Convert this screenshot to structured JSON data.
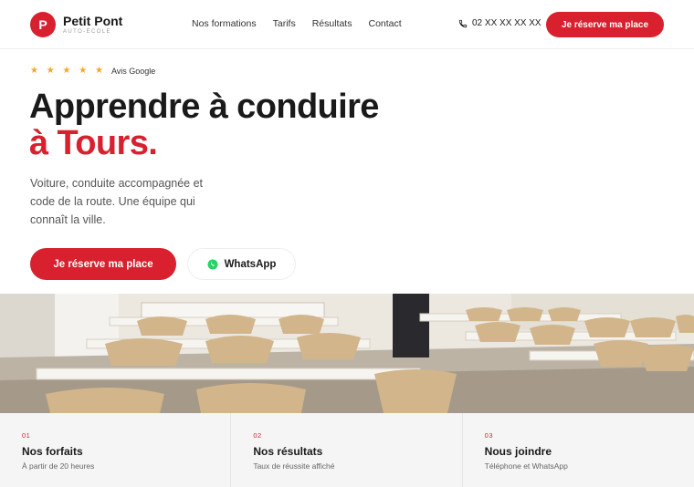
{
  "brand": {
    "mark": "P",
    "name": "Petit Pont",
    "tagline": "AUTO-ÉCOLE",
    "accent": "#d8202e"
  },
  "nav": [
    "Nos formations",
    "Tarifs",
    "Résultats",
    "Contact"
  ],
  "header": {
    "phone": "02 XX XX XX XX",
    "cta": "Je réserve ma place"
  },
  "hero": {
    "stars": "★ ★ ★ ★ ★",
    "reviews_label": "Avis Google",
    "title_line1": "Apprendre à conduire",
    "title_line2": "à Tours.",
    "lead": "Voiture, conduite accompagnée et code de la route. Une équipe qui connaît la ville.",
    "cta_primary": "Je réserve ma place",
    "cta_whatsapp": "WhatsApp"
  },
  "cards": [
    {
      "num": "01",
      "title": "Nos forfaits",
      "sub": "À partir de 20 heures"
    },
    {
      "num": "02",
      "title": "Nos résultats",
      "sub": "Taux de réussite affiché"
    },
    {
      "num": "03",
      "title": "Nous joindre",
      "sub": "Téléphone et WhatsApp"
    }
  ]
}
